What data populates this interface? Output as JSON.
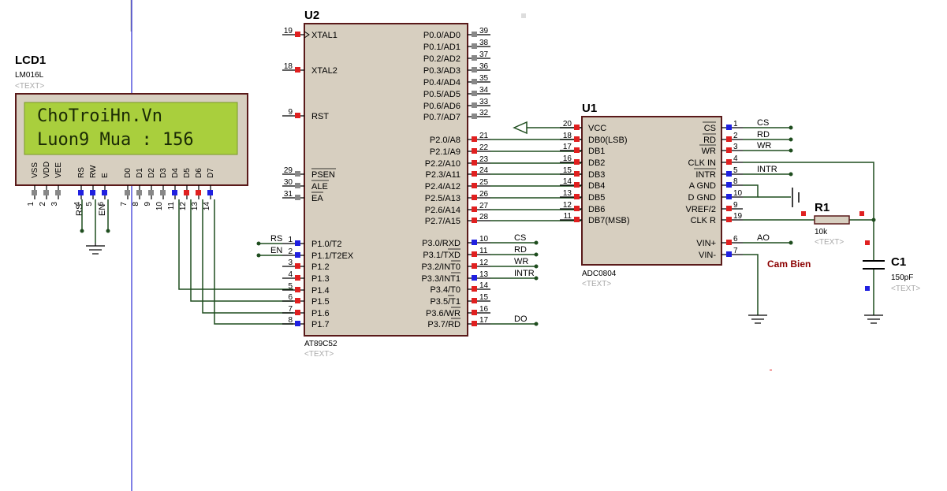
{
  "colors": {
    "chip_fill": "#d7cfc0",
    "lcd_screen": "#a9cf3d",
    "wire": "#1e4d1e",
    "pin_red": "#e02020",
    "pin_blue": "#2020e0",
    "pin_gray": "#888888",
    "sheet_line": "#0000cc",
    "label_red": "#8b0000"
  },
  "u2": {
    "ref": "U2",
    "part": "AT89C52",
    "placeholder": "<TEXT>",
    "left_pins": [
      {
        "num": "19",
        "name": "XTAL1",
        "net": ""
      },
      {
        "num": "18",
        "name": "XTAL2",
        "net": ""
      },
      {
        "num": "9",
        "name": "RST",
        "net": ""
      },
      {
        "num": "29",
        "name": "PSEN",
        "net": ""
      },
      {
        "num": "30",
        "name": "ALE",
        "net": ""
      },
      {
        "num": "31",
        "name": "EA",
        "net": ""
      },
      {
        "num": "1",
        "name": "P1.0/T2",
        "net": "RS"
      },
      {
        "num": "2",
        "name": "P1.1/T2EX",
        "net": "EN"
      },
      {
        "num": "3",
        "name": "P1.2",
        "net": ""
      },
      {
        "num": "4",
        "name": "P1.3",
        "net": ""
      },
      {
        "num": "5",
        "name": "P1.4",
        "net": ""
      },
      {
        "num": "6",
        "name": "P1.5",
        "net": ""
      },
      {
        "num": "7",
        "name": "P1.6",
        "net": ""
      },
      {
        "num": "8",
        "name": "P1.7",
        "net": ""
      }
    ],
    "right_pins": [
      {
        "num": "39",
        "name": "P0.0/AD0",
        "net": ""
      },
      {
        "num": "38",
        "name": "P0.1/AD1",
        "net": ""
      },
      {
        "num": "37",
        "name": "P0.2/AD2",
        "net": ""
      },
      {
        "num": "36",
        "name": "P0.3/AD3",
        "net": ""
      },
      {
        "num": "35",
        "name": "P0.4/AD4",
        "net": ""
      },
      {
        "num": "34",
        "name": "P0.5/AD5",
        "net": ""
      },
      {
        "num": "33",
        "name": "P0.6/AD6",
        "net": ""
      },
      {
        "num": "32",
        "name": "P0.7/AD7",
        "net": ""
      },
      {
        "num": "21",
        "name": "P2.0/A8",
        "net": ""
      },
      {
        "num": "22",
        "name": "P2.1/A9",
        "net": ""
      },
      {
        "num": "23",
        "name": "P2.2/A10",
        "net": ""
      },
      {
        "num": "24",
        "name": "P2.3/A11",
        "net": ""
      },
      {
        "num": "25",
        "name": "P2.4/A12",
        "net": ""
      },
      {
        "num": "26",
        "name": "P2.5/A13",
        "net": ""
      },
      {
        "num": "27",
        "name": "P2.6/A14",
        "net": ""
      },
      {
        "num": "28",
        "name": "P2.7/A15",
        "net": ""
      },
      {
        "num": "10",
        "name": "P3.0/RXD",
        "net": "CS"
      },
      {
        "num": "11",
        "name": "P3.1/TXD",
        "net": "RD"
      },
      {
        "num": "12",
        "name": "P3.2/INT0",
        "net": "WR"
      },
      {
        "num": "13",
        "name": "P3.3/INT1",
        "net": "INTR"
      },
      {
        "num": "14",
        "name": "P3.4/T0",
        "net": ""
      },
      {
        "num": "15",
        "name": "P3.5/T1",
        "net": ""
      },
      {
        "num": "16",
        "name": "P3.6/WR",
        "net": ""
      },
      {
        "num": "17",
        "name": "P3.7/RD",
        "net": "DO"
      }
    ]
  },
  "lcd": {
    "ref": "LCD1",
    "part": "LM016L",
    "placeholder": "<TEXT>",
    "line1": "ChoTroiHn.Vn",
    "line2": "Luon9 Mua : 156",
    "pins": [
      {
        "num": "1",
        "name": "VSS"
      },
      {
        "num": "2",
        "name": "VDD"
      },
      {
        "num": "3",
        "name": "VEE"
      },
      {
        "num": "4",
        "name": "RS"
      },
      {
        "num": "5",
        "name": "RW"
      },
      {
        "num": "6",
        "name": "E"
      },
      {
        "num": "7",
        "name": "D0"
      },
      {
        "num": "8",
        "name": "D1"
      },
      {
        "num": "9",
        "name": "D2"
      },
      {
        "num": "10",
        "name": "D3"
      },
      {
        "num": "11",
        "name": "D4"
      },
      {
        "num": "12",
        "name": "D5"
      },
      {
        "num": "13",
        "name": "D6"
      },
      {
        "num": "14",
        "name": "D7"
      }
    ],
    "rs_label": "RS",
    "en_label": "EN"
  },
  "u1": {
    "ref": "U1",
    "part": "ADC0804",
    "placeholder": "<TEXT>",
    "left_pins": [
      {
        "num": "20",
        "name": "VCC"
      },
      {
        "num": "18",
        "name": "DB0(LSB)"
      },
      {
        "num": "17",
        "name": "DB1"
      },
      {
        "num": "16",
        "name": "DB2"
      },
      {
        "num": "15",
        "name": "DB3"
      },
      {
        "num": "14",
        "name": "DB4"
      },
      {
        "num": "13",
        "name": "DB5"
      },
      {
        "num": "12",
        "name": "DB6"
      },
      {
        "num": "11",
        "name": "DB7(MSB)"
      }
    ],
    "right_pins": [
      {
        "num": "1",
        "name": "CS",
        "net": "CS"
      },
      {
        "num": "2",
        "name": "RD",
        "net": "RD"
      },
      {
        "num": "3",
        "name": "WR",
        "net": "WR"
      },
      {
        "num": "4",
        "name": "CLK IN",
        "net": ""
      },
      {
        "num": "5",
        "name": "INTR",
        "net": "INTR"
      },
      {
        "num": "8",
        "name": "A GND",
        "net": ""
      },
      {
        "num": "10",
        "name": "D GND",
        "net": ""
      },
      {
        "num": "9",
        "name": "VREF/2",
        "net": ""
      },
      {
        "num": "19",
        "name": "CLK R",
        "net": ""
      },
      {
        "num": "6",
        "name": "VIN+",
        "net": "AO"
      },
      {
        "num": "7",
        "name": "VIN-",
        "net": ""
      }
    ]
  },
  "r1": {
    "ref": "R1",
    "value": "10k",
    "placeholder": "<TEXT>"
  },
  "c1": {
    "ref": "C1",
    "value": "150pF",
    "placeholder": "<TEXT>"
  },
  "sensor_label": "Cam Bien"
}
